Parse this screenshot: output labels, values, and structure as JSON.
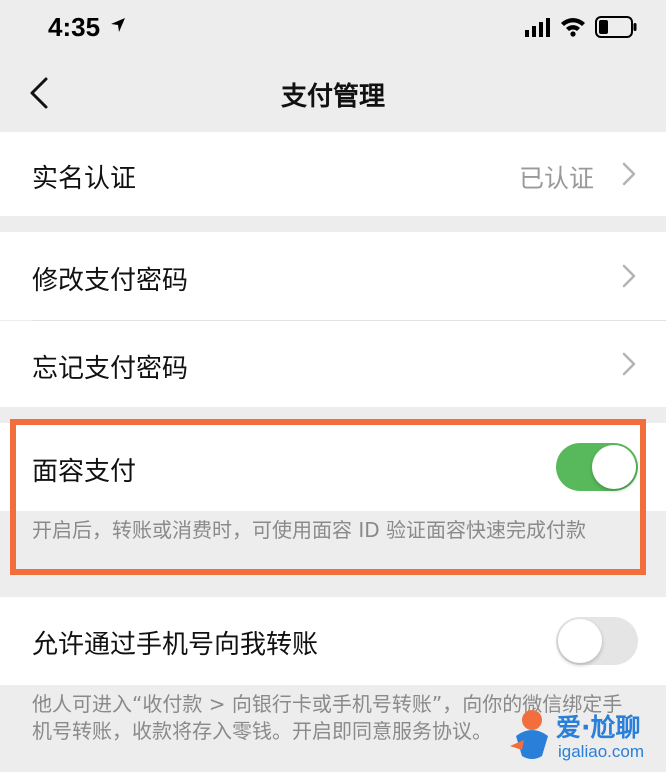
{
  "status_bar": {
    "time": "4:35"
  },
  "nav": {
    "title": "支付管理"
  },
  "rows": {
    "real_name": {
      "label": "实名认证",
      "value": "已认证"
    },
    "change_password": {
      "label": "修改支付密码"
    },
    "forgot_password": {
      "label": "忘记支付密码"
    },
    "face_pay": {
      "label": "面容支付",
      "enabled": true,
      "note": "开启后，转账或消费时，可使用面容 ID 验证面容快速完成付款"
    },
    "phone_transfer": {
      "label": "允许通过手机号向我转账",
      "enabled": false,
      "note": "他人可进入“收付款 > 向银行卡或手机号转账”，向你的微信绑定手机号转账，收款将存入零钱。开启即同意服务协议。"
    }
  },
  "watermark": {
    "title": "爱·尬聊",
    "url": "igaliao.com"
  },
  "colors": {
    "toggle_on": "#58b95c",
    "highlight": "#f26e3c",
    "page_bg": "#ededed"
  },
  "icons": [
    "location-arrow-icon",
    "signal-icon",
    "wifi-icon",
    "battery-icon",
    "back-arrow-icon",
    "chevron-right-icon"
  ]
}
